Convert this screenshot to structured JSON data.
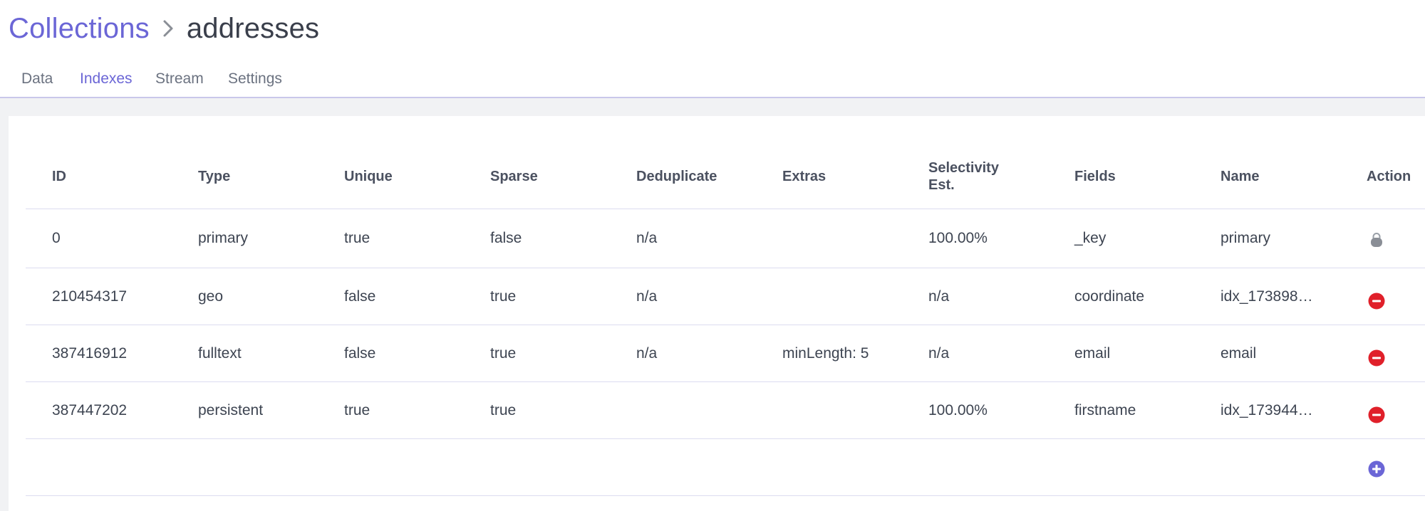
{
  "breadcrumb": {
    "root": "Collections",
    "current": "addresses"
  },
  "tabs": [
    {
      "label": "Data"
    },
    {
      "label": "Indexes",
      "active": true
    },
    {
      "label": "Stream"
    },
    {
      "label": "Settings"
    }
  ],
  "table": {
    "headers": {
      "id": "ID",
      "type": "Type",
      "unique": "Unique",
      "sparse": "Sparse",
      "deduplicate": "Deduplicate",
      "extras": "Extras",
      "selectivity": "Selectivity Est.",
      "fields": "Fields",
      "name": "Name",
      "action": "Action"
    },
    "rows": [
      {
        "id": "0",
        "type": "primary",
        "unique": "true",
        "sparse": "false",
        "deduplicate": "n/a",
        "extras": "",
        "selectivity": "100.00%",
        "fields": "_key",
        "name": "primary",
        "action_icon": "lock-icon"
      },
      {
        "id": "210454317",
        "type": "geo",
        "unique": "false",
        "sparse": "true",
        "deduplicate": "n/a",
        "extras": "",
        "selectivity": "n/a",
        "fields": "coordinate",
        "name": "idx_173898…",
        "action_icon": "delete-icon"
      },
      {
        "id": "387416912",
        "type": "fulltext",
        "unique": "false",
        "sparse": "true",
        "deduplicate": "n/a",
        "extras": "minLength: 5",
        "selectivity": "n/a",
        "fields": "email",
        "name": "email",
        "action_icon": "delete-icon"
      },
      {
        "id": "387447202",
        "type": "persistent",
        "unique": "true",
        "sparse": "true",
        "deduplicate": "",
        "extras": "",
        "selectivity": "100.00%",
        "fields": "firstname",
        "name": "idx_173944…",
        "action_icon": "delete-icon"
      }
    ],
    "add_icon": "add-icon"
  },
  "colors": {
    "accent": "#6b66d6",
    "delete": "#e0202a",
    "lock": "#8a8e96",
    "background_band": "#f1f2f4"
  }
}
